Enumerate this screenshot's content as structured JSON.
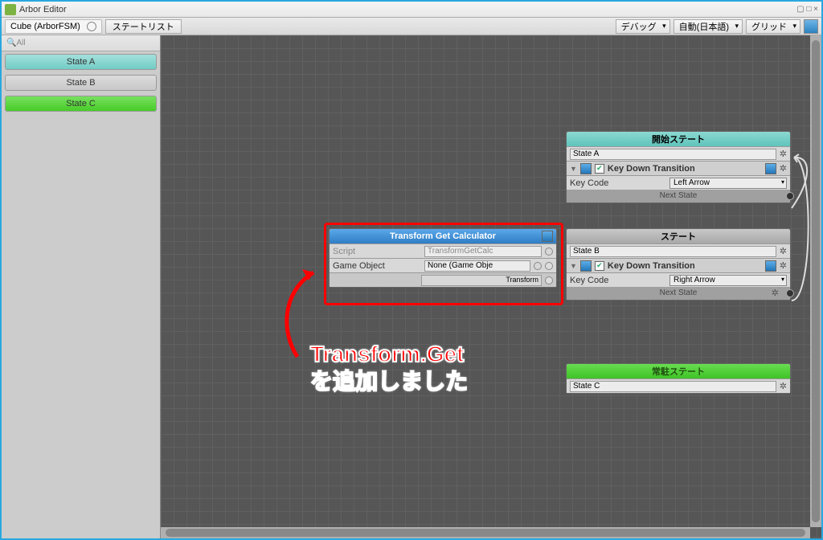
{
  "window": {
    "title": "Arbor Editor"
  },
  "toolbar": {
    "breadcrumb": "Cube (ArborFSM)",
    "stateList": "ステートリスト",
    "debug": "デバッグ",
    "lang": "自動(日本語)",
    "grid": "グリッド"
  },
  "sidebar": {
    "searchPlaceholder": "All",
    "states": {
      "a": "State A",
      "b": "State B",
      "c": "State C"
    }
  },
  "calcNode": {
    "title": "Transform Get Calculator",
    "scriptLabel": "Script",
    "scriptValue": "TransformGetCalc",
    "goLabel": "Game Object",
    "goValue": "None (Game Obje",
    "outLabel": "Transform"
  },
  "startNode": {
    "header": "開始ステート",
    "name": "State A",
    "transTitle": "Key Down Transition",
    "keyCodeLabel": "Key Code",
    "keyCodeValue": "Left Arrow",
    "next": "Next State"
  },
  "stateNode": {
    "header": "ステート",
    "name": "State B",
    "transTitle": "Key Down Transition",
    "keyCodeLabel": "Key Code",
    "keyCodeValue": "Right Arrow",
    "next": "Next State"
  },
  "residentNode": {
    "header": "常駐ステート",
    "name": "State C"
  },
  "annotation": {
    "line1": "Transform.Get",
    "line2": "を追加しました"
  }
}
